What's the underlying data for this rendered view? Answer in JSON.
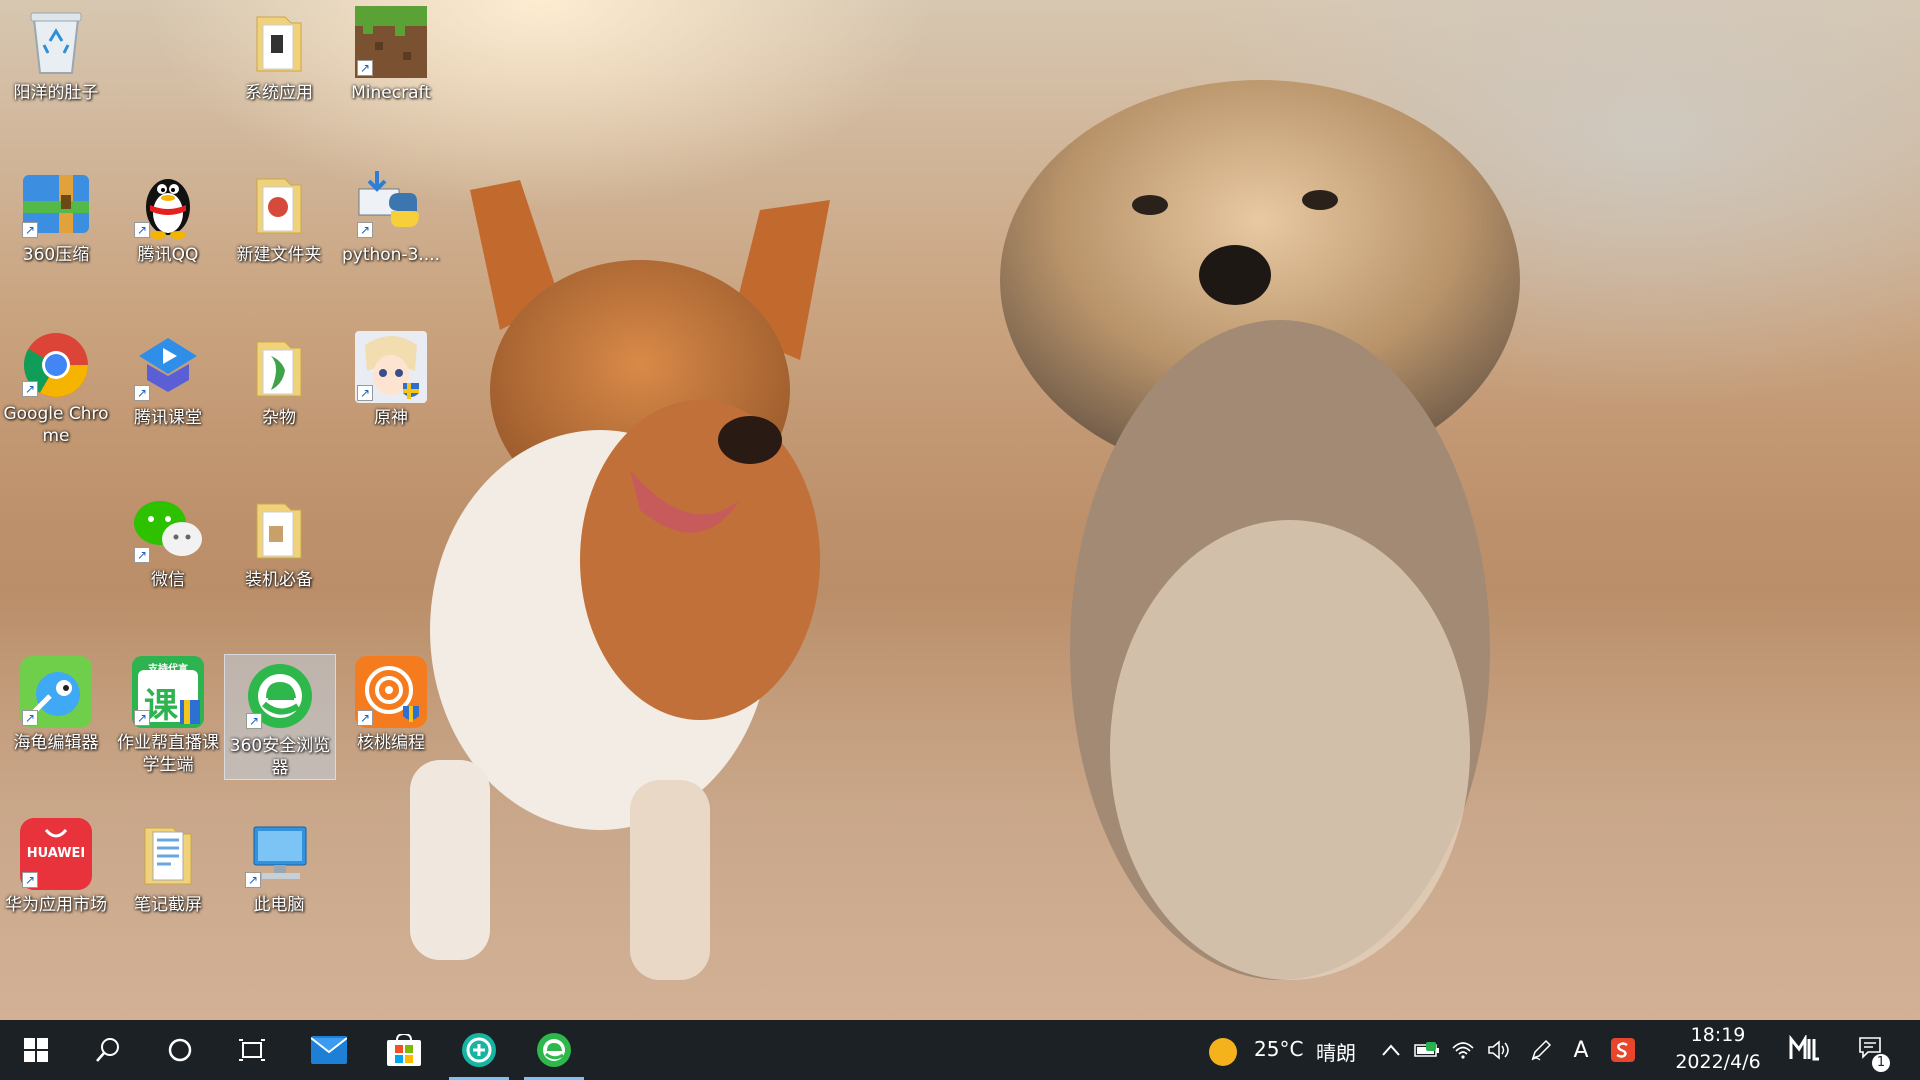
{
  "desktop": {
    "icons": [
      {
        "label": "阳洋的肚子",
        "icon": "recycle-bin-icon"
      },
      {
        "label": "系统应用",
        "icon": "folder-icon"
      },
      {
        "label": "Minecraft",
        "icon": "minecraft-icon"
      },
      {
        "label": "360压缩",
        "icon": "360-zip-icon"
      },
      {
        "label": "腾讯QQ",
        "icon": "qq-penguin-icon"
      },
      {
        "label": "新建文件夹",
        "icon": "folder-icon"
      },
      {
        "label": "python-3....",
        "icon": "python-installer-icon"
      },
      {
        "label": "Google Chrome",
        "icon": "chrome-icon"
      },
      {
        "label": "腾讯课堂",
        "icon": "tencent-classroom-icon"
      },
      {
        "label": "杂物",
        "icon": "folder-icon"
      },
      {
        "label": "原神",
        "icon": "genshin-icon"
      },
      {
        "label": "微信",
        "icon": "wechat-icon"
      },
      {
        "label": "装机必备",
        "icon": "folder-icon"
      },
      {
        "label": "海龟编辑器",
        "icon": "turtle-editor-icon"
      },
      {
        "label": "作业帮直播课学生端",
        "icon": "zuoyebang-icon",
        "badge": "课",
        "banner": "支持代言"
      },
      {
        "label": "360安全浏览器",
        "icon": "360-browser-icon"
      },
      {
        "label": "核桃编程",
        "icon": "hetao-icon"
      },
      {
        "label": "华为应用市场",
        "icon": "huawei-appgallery-icon",
        "badge": "HUAWEI"
      },
      {
        "label": "笔记截屏",
        "icon": "notes-icon"
      },
      {
        "label": "此电脑",
        "icon": "this-pc-icon"
      }
    ]
  },
  "taskbar": {
    "weather_temp": "25°C",
    "weather_text": "晴朗",
    "time": "18:19",
    "date": "2022/4/6",
    "ime_label": "A",
    "notification_count": "1",
    "apps": [
      "start",
      "search",
      "cortana",
      "task-view",
      "mail",
      "store",
      "app-green",
      "360-browser"
    ]
  },
  "colors": {
    "taskbar_bg": "#1b2125",
    "accent": "#7cc1f0",
    "selection": "#bed7f0"
  }
}
